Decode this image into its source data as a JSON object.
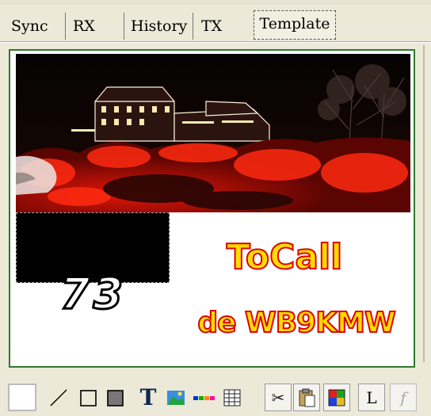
{
  "tabs": [
    {
      "id": "sync",
      "label": "Sync"
    },
    {
      "id": "rx",
      "label": "RX"
    },
    {
      "id": "history",
      "label": "History"
    },
    {
      "id": "tx",
      "label": "TX"
    },
    {
      "id": "template",
      "label": "Template",
      "active": true
    }
  ],
  "template_canvas": {
    "photo": "night-scene-with-red-christmas-lights",
    "text_73": "73",
    "text_tocall": "ToCall",
    "text_de": "de WB9KMW",
    "text_colors": {
      "fill": "#ffdd00",
      "outline": "#e00000"
    }
  },
  "toolbar": {
    "icons": [
      "blank",
      "line-tool-icon",
      "rectangle-tool-icon",
      "filled-rectangle-tool-icon",
      "text-tool-icon",
      "image-tool-icon",
      "color-bar-icon",
      "grid-tool-icon",
      "cut-icon",
      "paste-icon",
      "color-palette-icon",
      "L",
      "f"
    ],
    "text_tool_label": "T",
    "l_label": "L",
    "f_label": "f"
  },
  "colors": {
    "frame": "#2d7b2d",
    "window": "#ece9d8"
  }
}
